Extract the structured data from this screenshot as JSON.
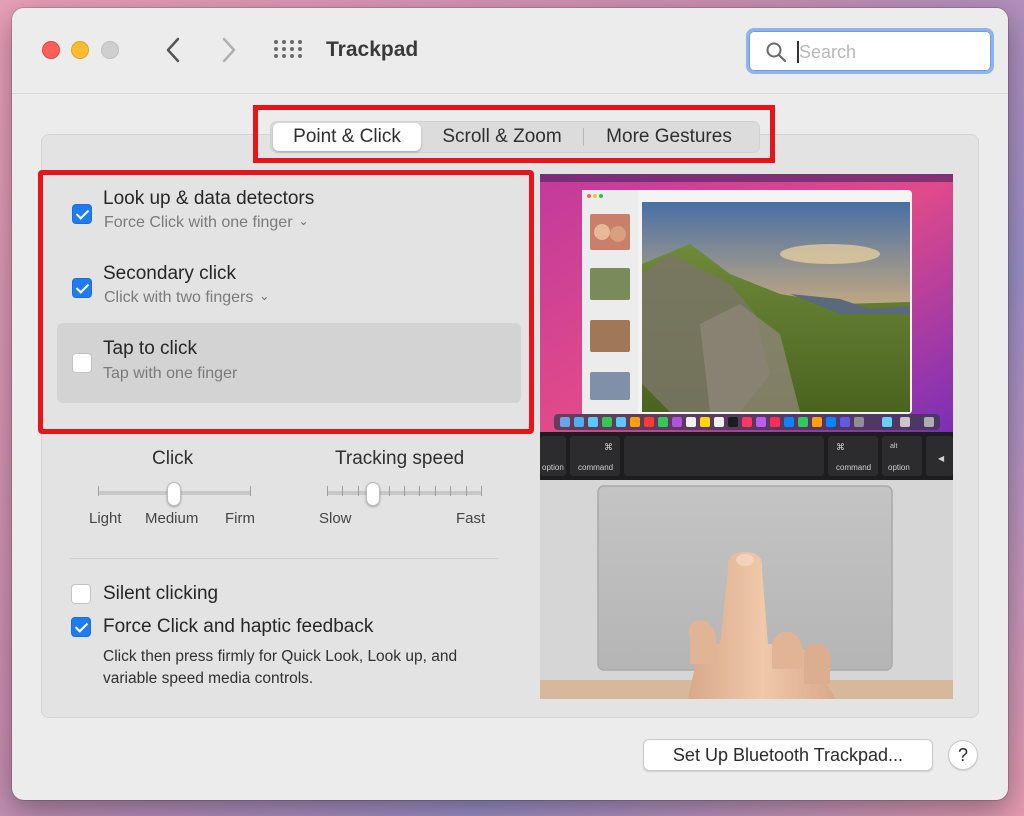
{
  "window": {
    "title": "Trackpad",
    "search_placeholder": "Search"
  },
  "tabs": [
    {
      "label": "Point & Click",
      "selected": true
    },
    {
      "label": "Scroll & Zoom",
      "selected": false
    },
    {
      "label": "More Gestures",
      "selected": false
    }
  ],
  "options": [
    {
      "title": "Look up & data detectors",
      "subtitle": "Force Click with one finger",
      "checked": true,
      "has_dropdown": true
    },
    {
      "title": "Secondary click",
      "subtitle": "Click with two fingers",
      "checked": true,
      "has_dropdown": true
    },
    {
      "title": "Tap to click",
      "subtitle": "Tap with one finger",
      "checked": false,
      "has_dropdown": false
    }
  ],
  "click_slider": {
    "label": "Click",
    "ticks": [
      "Light",
      "Medium",
      "Firm"
    ],
    "value": "Medium"
  },
  "tracking_slider": {
    "label": "Tracking speed",
    "min_label": "Slow",
    "max_label": "Fast",
    "value_fraction": 0.3
  },
  "silent_clicking": {
    "label": "Silent clicking",
    "checked": false
  },
  "force_click": {
    "label": "Force Click and haptic feedback",
    "checked": true,
    "description": "Click then press firmly for Quick Look, Look up, and variable speed media controls."
  },
  "preview_keys": {
    "option_left": "option",
    "command_left": "command",
    "command_right": "command",
    "option_right": "option",
    "alt": "alt"
  },
  "buttons": {
    "setup_bluetooth": "Set Up Bluetooth Trackpad...",
    "help": "?"
  },
  "colors": {
    "accent": "#1e7bf2",
    "highlight_border": "#e8141c"
  }
}
